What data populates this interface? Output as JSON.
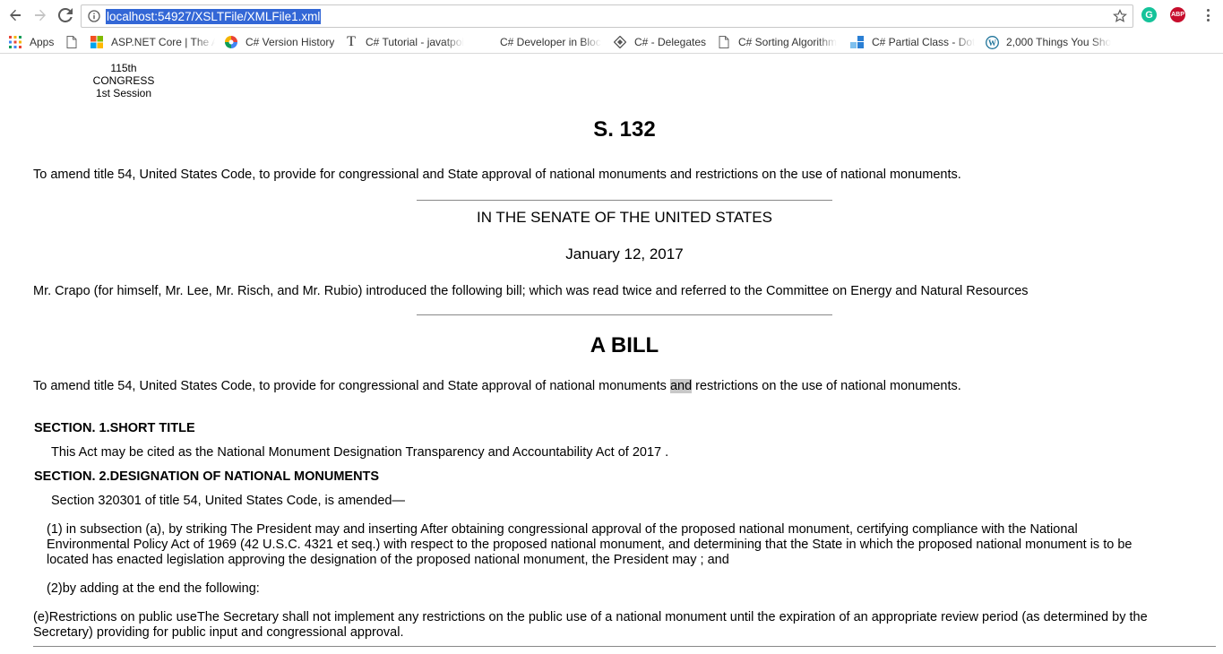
{
  "browser": {
    "url": "localhost:54927/XSLTFile/XMLFile1.xml",
    "bookmarks": [
      {
        "label": "Apps",
        "icon": "apps-grid-icon"
      },
      {
        "label": "",
        "icon": "page-icon"
      },
      {
        "label": "ASP.NET Core | The A",
        "icon": "windows-logo-icon"
      },
      {
        "label": "C# Version History",
        "icon": "pinwheel-icon"
      },
      {
        "label": "C# Tutorial - javatpoi",
        "icon": "t-letter-icon"
      },
      {
        "label": "C# Developer in Bloc",
        "icon": "blank-icon"
      },
      {
        "label": "C# - Delegates",
        "icon": "diamond-icon"
      },
      {
        "label": "C# Sorting Algorithm",
        "icon": "page-icon"
      },
      {
        "label": "C# Partial Class - Dot",
        "icon": "blocks-icon"
      },
      {
        "label": "2,000 Things You Sho",
        "icon": "wordpress-icon"
      }
    ],
    "extensions": {
      "grammarly": "G",
      "adblock": "ABP"
    }
  },
  "document": {
    "congress": "115th CONGRESS",
    "session": "1st Session",
    "bill_number": "S. 132",
    "official_title": "To amend title 54, United States Code, to provide for congressional and State approval of national monuments and restrictions on the use of national monuments.",
    "chamber": "IN THE SENATE OF THE UNITED STATES",
    "date": "January 12, 2017",
    "action": "Mr. Crapo (for himself, Mr. Lee, Mr. Risch, and Mr. Rubio) introduced the following bill; which was read twice and referred to the Committee on Energy and Natural Resources",
    "bill_heading": "A BILL",
    "long_title_before": "To amend title 54, United States Code, to provide for congressional and State approval of national monuments ",
    "long_title_highlight": "and",
    "long_title_after": " restrictions on the use of national monuments.",
    "section1_heading": "SECTION. 1.SHORT TITLE",
    "section1_text": "This Act may be cited as the National Monument Designation Transparency and Accountability Act of 2017 .",
    "section2_heading": "SECTION. 2.DESIGNATION OF NATIONAL MONUMENTS",
    "section2_text": "Section 320301 of title 54, United States Code, is amended—",
    "para1_line1": "(1) in subsection (a), by striking The President may and inserting After obtaining congressional approval of the proposed national monument, certifying compliance with the National",
    "para1_line2": "Environmental Policy Act of 1969 (42 U.S.C. 4321 et seq.) with respect to the proposed national monument, and determining that the State in which the proposed national monument is to be",
    "para1_line3": "located has enacted legislation approving the designation of the proposed national monument, the President may ; and",
    "para2": "(2)by adding at the end the following:",
    "para_e_line1": "(e)Restrictions on public useThe Secretary shall not implement any restrictions on the public use of a national monument until the expiration of an appropriate review period (as determined by the",
    "para_e_line2": "Secretary) providing for public input and congressional approval."
  }
}
